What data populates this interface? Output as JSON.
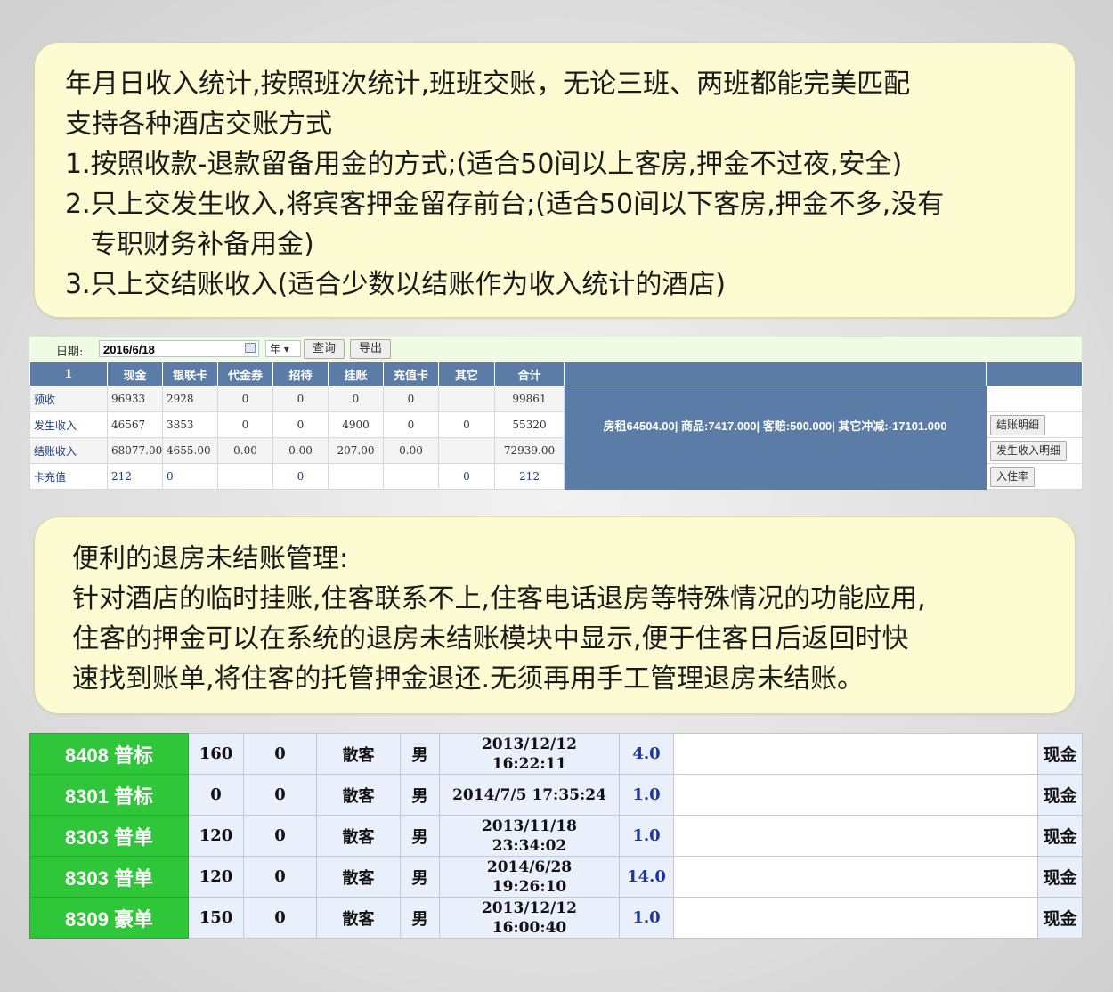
{
  "note1": {
    "lines": [
      "年月日收入统计,按照班次统计,班班交账，无论三班、两班都能完美匹配",
      "支持各种酒店交账方式",
      "1.按照收款-退款留备用金的方式;(适合50间以上客房,押金不过夜,安全)",
      "2.只上交发生收入,将宾客押金留存前台;(适合50间以下客房,押金不多,没有",
      "专职财务补备用金)",
      "3.只上交结账收入(适合少数以结账作为收入统计的酒店)"
    ]
  },
  "toolbar": {
    "date_label": "日期:",
    "date_value": "2016/6/18",
    "period_select": "年",
    "query_button": "查询",
    "export_button": "导出"
  },
  "report": {
    "headers": [
      "1",
      "现金",
      "银联卡",
      "代金券",
      "招待",
      "挂账",
      "充值卡",
      "其它",
      "合计"
    ],
    "rows": [
      {
        "label": "预收",
        "cells": [
          "96933",
          "2928",
          "0",
          "0",
          "0",
          "0",
          "",
          "99861"
        ]
      },
      {
        "label": "发生收入",
        "cells": [
          "46567",
          "3853",
          "0",
          "0",
          "4900",
          "0",
          "0",
          "55320"
        ]
      },
      {
        "label": "结账收入",
        "cells": [
          "68077.00",
          "4655.00",
          "0.00",
          "0.00",
          "207.00",
          "0.00",
          "",
          "72939.00"
        ]
      },
      {
        "label": "卡充值",
        "cells": [
          "212",
          "0",
          "",
          "0",
          "",
          "",
          "0",
          "212"
        ]
      }
    ],
    "summary": "房租64504.00| 商品:7417.000| 客赔:500.000| 其它冲减:-17101.000",
    "buttons": {
      "checkout_detail": "结账明细",
      "income_detail": "发生收入明细",
      "occupancy": "入住率"
    }
  },
  "note2": {
    "lines": [
      "便利的退房未结账管理:",
      "针对酒店的临时挂账,住客联系不上,住客电话退房等特殊情况的功能应用,",
      "住客的押金可以在系统的退房未结账模块中显示,便于住客日后返回时快",
      "速找到账单,将住客的托管押金退还.无须再用手工管理退房未结账。"
    ]
  },
  "rooms": [
    {
      "room": "8408 普标",
      "rate": "160",
      "deposit": "0",
      "type": "散客",
      "gender": "男",
      "time1": "2013/12/12",
      "time2": "16:22:11",
      "nights": "4.0",
      "pay": "现金"
    },
    {
      "room": "8301 普标",
      "rate": "0",
      "deposit": "0",
      "type": "散客",
      "gender": "男",
      "time1": "2014/7/5 17:35:24",
      "time2": "",
      "nights": "1.0",
      "pay": "现金"
    },
    {
      "room": "8303 普单",
      "rate": "120",
      "deposit": "0",
      "type": "散客",
      "gender": "男",
      "time1": "2013/11/18",
      "time2": "23:34:02",
      "nights": "1.0",
      "pay": "现金"
    },
    {
      "room": "8303 普单",
      "rate": "120",
      "deposit": "0",
      "type": "散客",
      "gender": "男",
      "time1": "2014/6/28",
      "time2": "19:26:10",
      "nights": "14.0",
      "pay": "现金"
    },
    {
      "room": "8309 豪单",
      "rate": "150",
      "deposit": "0",
      "type": "散客",
      "gender": "男",
      "time1": "2013/12/12",
      "time2": "16:00:40",
      "nights": "1.0",
      "pay": "现金"
    }
  ]
}
